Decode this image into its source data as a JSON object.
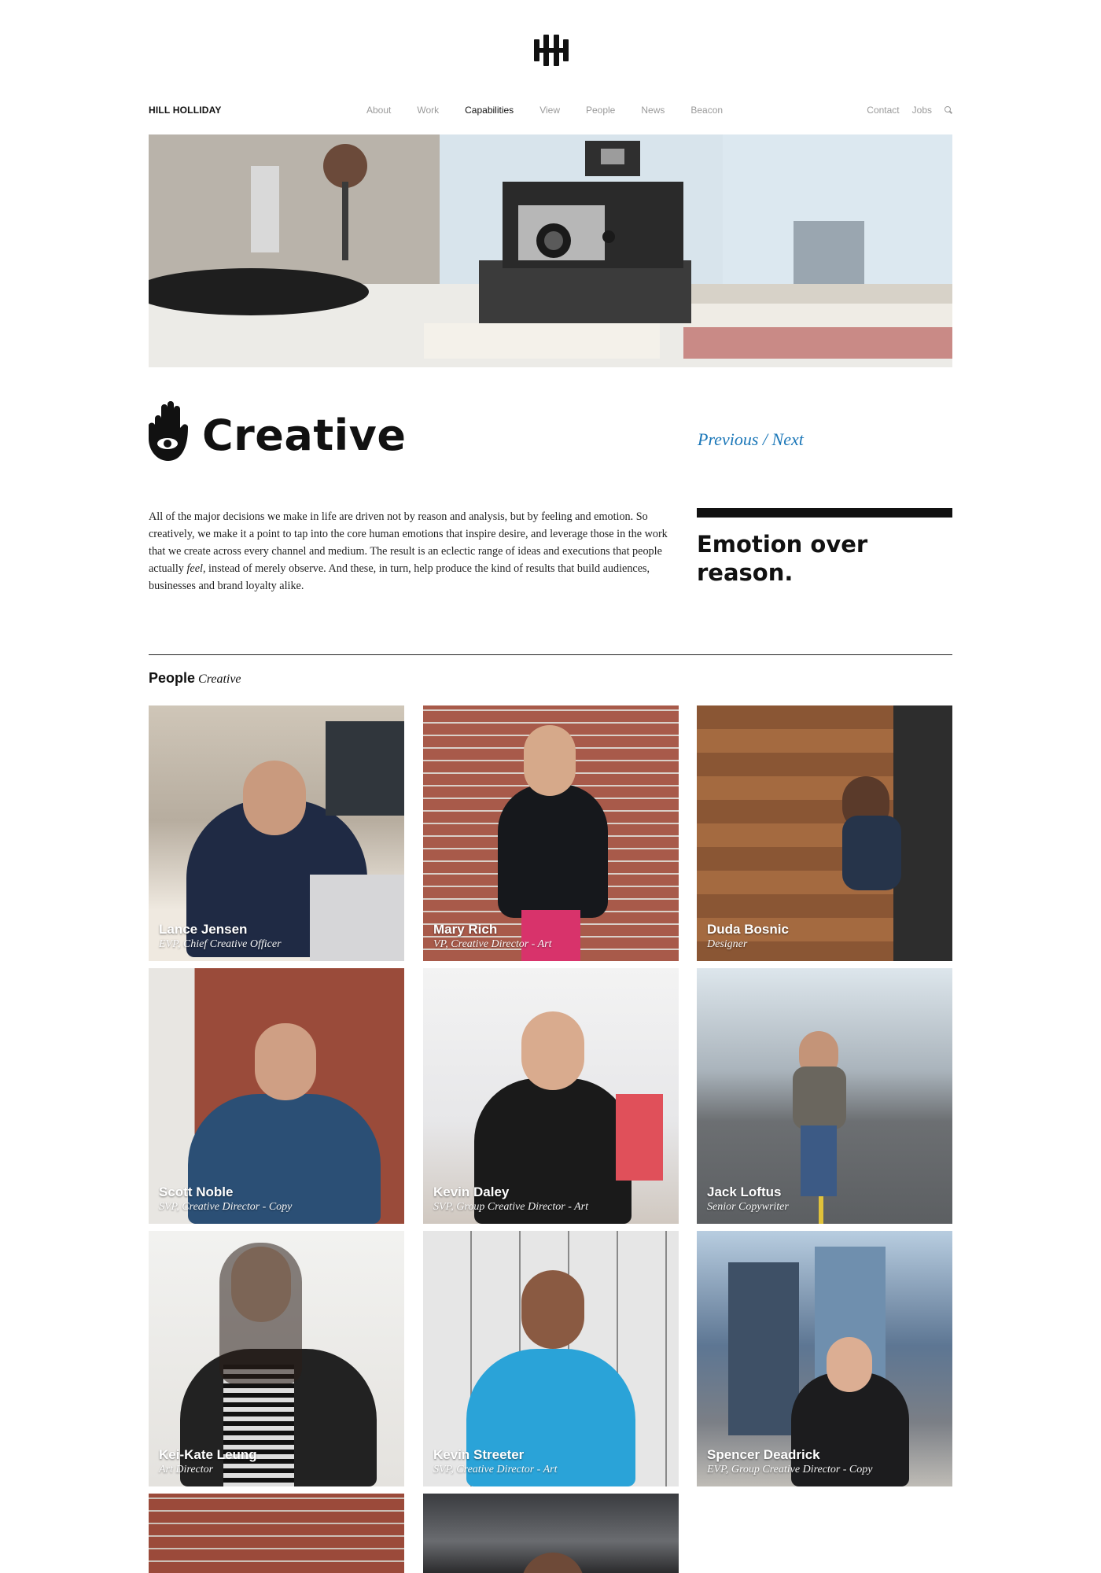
{
  "brand": "HILL HOLLIDAY",
  "nav": {
    "items": [
      "About",
      "Work",
      "Capabilities",
      "View",
      "People",
      "News",
      "Beacon"
    ],
    "active": "Capabilities",
    "right": [
      "Contact",
      "Jobs"
    ]
  },
  "page": {
    "title": "Creative",
    "previous": "Previous",
    "separator": "/",
    "next": "Next"
  },
  "intro": {
    "before_em": "All of the major decisions we make in life are driven not by reason and analysis, but by feeling and emotion. So creatively, we make it a point to tap into the core human emotions that inspire desire, and leverage those in the work that we create across every channel and medium. The result is an eclectic range of ideas and executions that people actually ",
    "em": "feel",
    "after_em": ", instead of merely observe. And these, in turn, help produce the kind of results that build audiences, businesses and brand loyalty alike."
  },
  "quote": "Emotion over reason.",
  "people_section": {
    "title": "People",
    "subtitle": "Creative"
  },
  "people": [
    {
      "name": "Lance Jensen",
      "role": "EVP, Chief Creative Officer"
    },
    {
      "name": "Mary Rich",
      "role": "VP, Creative Director - Art"
    },
    {
      "name": "Duda Bosnic",
      "role": "Designer"
    },
    {
      "name": "Scott Noble",
      "role": "SVP, Creative Director - Copy"
    },
    {
      "name": "Kevin Daley",
      "role": "SVP, Group Creative Director - Art"
    },
    {
      "name": "Jack Loftus",
      "role": "Senior Copywriter"
    },
    {
      "name": "Kei-Kate Leung",
      "role": "Art Director"
    },
    {
      "name": "Kevin Streeter",
      "role": "SVP, Creative Director - Art"
    },
    {
      "name": "Spencer Deadrick",
      "role": "EVP, Group Creative Director - Copy"
    }
  ],
  "colors": {
    "accent_link": "#1b77b8",
    "nav_inactive": "#9a9a9a",
    "text": "#111111"
  }
}
